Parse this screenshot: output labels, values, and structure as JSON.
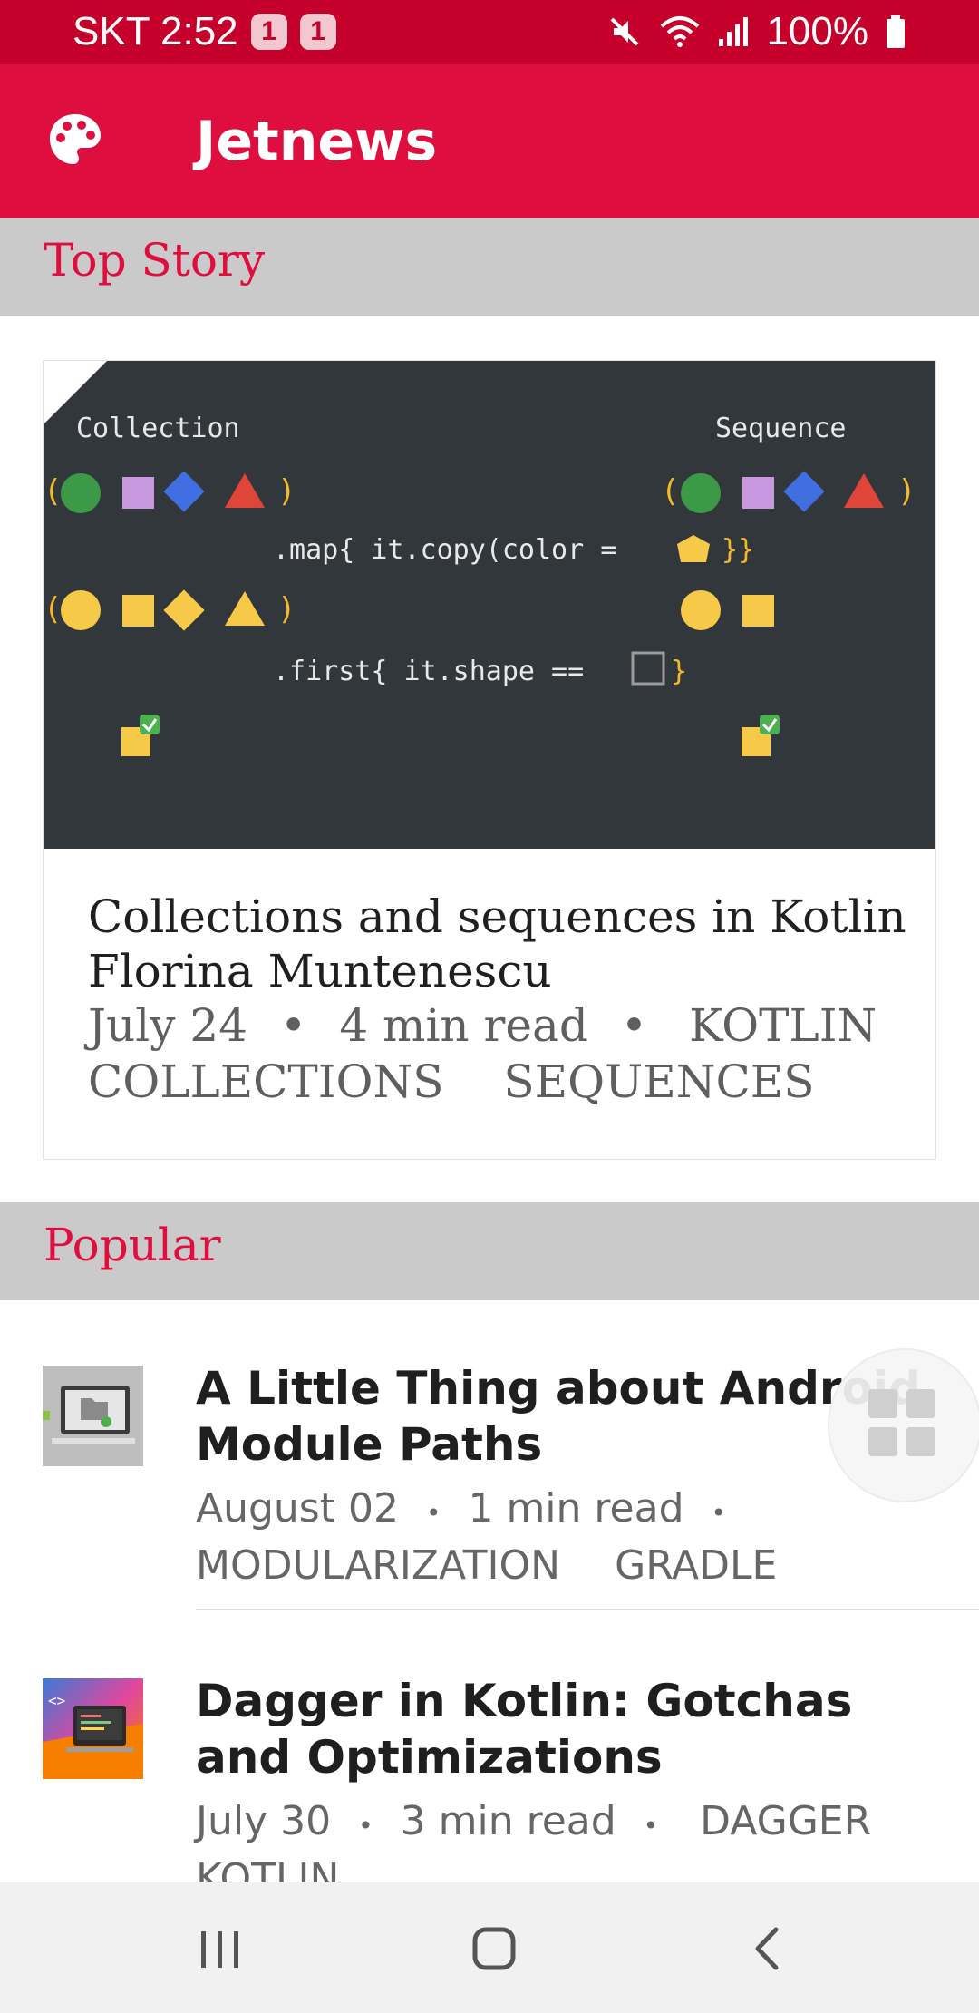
{
  "status": {
    "carrier_time": "SKT 2:52",
    "badges": [
      "1",
      "1"
    ],
    "battery": "100%"
  },
  "app": {
    "title": "Jetnews"
  },
  "sections": {
    "top_story": "Top Story",
    "popular": "Popular"
  },
  "top_story": {
    "image": {
      "left_label": "Collection",
      "right_label": "Sequence",
      "code_map": ".map{ it.copy(color = ",
      "code_map_end": "}}",
      "code_first": ".first{ it.shape == ",
      "code_first_end": "}",
      "paren_open": "(",
      "paren_close": ")"
    },
    "title": "Collections and sequences in Kotlin",
    "author": "Florina Muntenescu",
    "date": "July 24",
    "read_time": "4 min read",
    "tags": [
      "KOTLIN",
      "COLLECTIONS",
      "SEQUENCES"
    ]
  },
  "popular": [
    {
      "title": "A Little Thing about Android Module Paths",
      "date": "August 02",
      "read_time": "1 min read",
      "tags": [
        "MODULARIZATION",
        "GRADLE"
      ]
    },
    {
      "title": "Dagger in Kotlin: Gotchas and Optimizations",
      "date": "July 30",
      "read_time": "3 min read",
      "tags": [
        "DAGGER",
        "KOTLIN"
      ]
    }
  ],
  "separator": "•",
  "colors": {
    "primary": "#de0f3f",
    "status_bar": "#c4002b",
    "section_bg": "#cacaca"
  },
  "icons": {
    "app_bar": "palette-icon",
    "status": [
      "mute-icon",
      "wifi-icon",
      "signal-icon",
      "battery-icon"
    ],
    "floating": "grid-icon",
    "nav": [
      "recents-icon",
      "home-icon",
      "back-icon"
    ]
  }
}
